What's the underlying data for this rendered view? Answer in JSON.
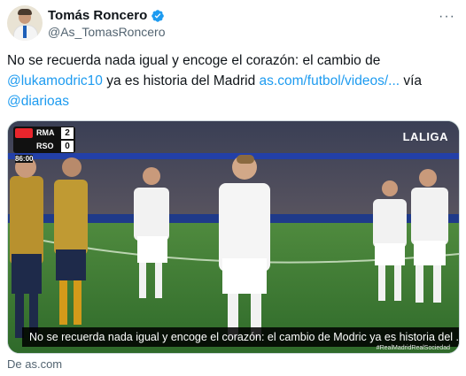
{
  "author": {
    "name": "Tomás Roncero",
    "handle": "@As_TomasRoncero",
    "verified": true
  },
  "more_label": "···",
  "tweet": {
    "text_before": "No se recuerda nada igual y encoge el corazón: el cambio de ",
    "mention": "@lukamodric10",
    "text_middle": " ya es historia del Madrid ",
    "url": "as.com/futbol/videos/...",
    "text_after": " vía ",
    "via": "@diarioas"
  },
  "video": {
    "scoreboard": {
      "clock": "86:00",
      "home_team": "RMA",
      "home_score": "2",
      "away_team": "RSO",
      "away_score": "0"
    },
    "broadcaster": "LALIGA",
    "caption": "No se recuerda nada igual y encoge el corazón: el cambio de Modric ya es historia del ...",
    "hashtag": "#RealMadridRealSociedad"
  },
  "source": "De as.com",
  "colors": {
    "link": "#1d9bf0",
    "verified": "#1d9bf0",
    "text": "#0f1419",
    "secondary": "#536471"
  }
}
